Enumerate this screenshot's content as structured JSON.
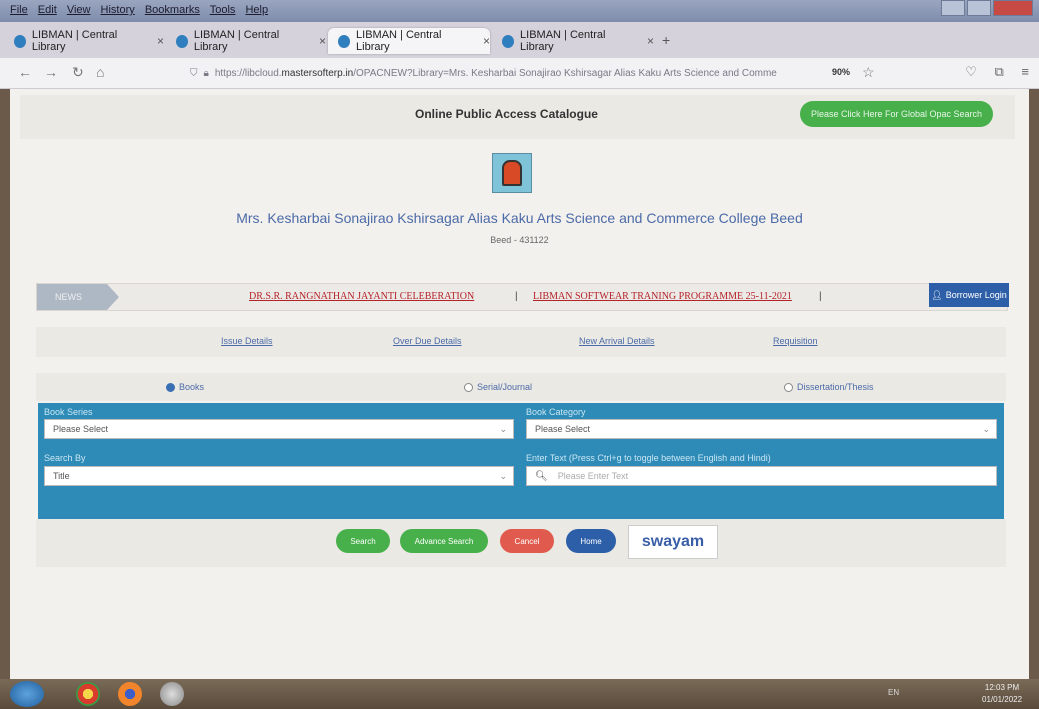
{
  "browser": {
    "menu": [
      "File",
      "Edit",
      "View",
      "History",
      "Bookmarks",
      "Tools",
      "Help"
    ],
    "tabs": [
      {
        "title": "LIBMAN | Central Library"
      },
      {
        "title": "LIBMAN | Central Library"
      },
      {
        "title": "LIBMAN | Central Library"
      },
      {
        "title": "LIBMAN | Central Library"
      }
    ],
    "new_tab": "+",
    "url_prefix": "https://libcloud.",
    "url_host": "mastersofterp.in",
    "url_path": "/OPACNEW?Library=Mrs. Kesharbai Sonajirao Kshirsagar Alias Kaku Arts Science and Comme",
    "zoom": "90%"
  },
  "header": {
    "title": "Online Public Access Catalogue",
    "global_search": "Please Click Here For Global Opac Search",
    "college": "Mrs. Kesharbai Sonajirao Kshirsagar Alias Kaku Arts Science and Commerce College Beed",
    "location": "Beed - 431122"
  },
  "news": {
    "label": "NEWS",
    "items": [
      "DR.S.R. RANGNATHAN JAYANTI CELEBERATION",
      "LIBMAN SOFTWEAR TRANING PROGRAMME 25-11-2021"
    ],
    "separator": "|",
    "borrower_login": "Borrower Login"
  },
  "links": [
    "Issue Details",
    "Over Due Details",
    "New Arrival Details",
    "Requisition"
  ],
  "types": [
    "Books",
    "Serial/Journal",
    "Dissertation/Thesis"
  ],
  "form": {
    "book_series_label": "Book Series",
    "book_series_value": "Please Select",
    "book_category_label": "Book Category",
    "book_category_value": "Please Select",
    "search_by_label": "Search By",
    "search_by_value": "Title",
    "enter_text_label": "Enter Text   (Press Ctrl+g to toggle between English and Hindi)",
    "enter_text_placeholder": "Please Enter Text"
  },
  "buttons": {
    "search": "Search",
    "advance": "Advance Search",
    "cancel": "Cancel",
    "home": "Home",
    "swayam": "swayam"
  },
  "taskbar": {
    "lang": "EN",
    "time": "12:03 PM",
    "date": "01/01/2022"
  },
  "colors": {
    "accent": "#2e8bb8",
    "green": "#47b04b",
    "red": "#e05a4e",
    "navy": "#2d5fa8"
  }
}
